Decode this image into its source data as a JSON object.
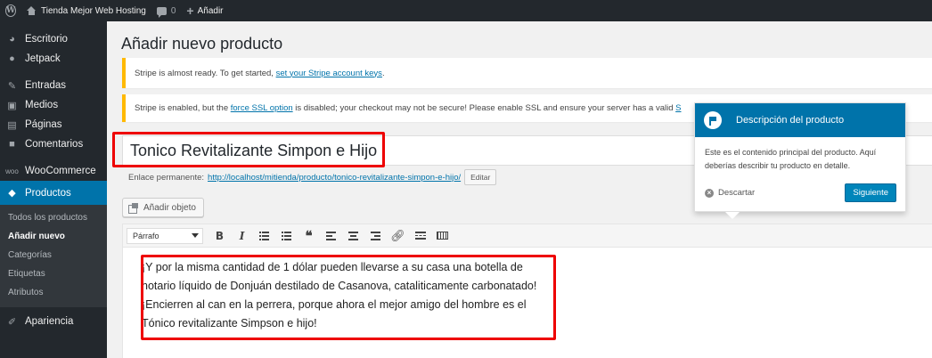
{
  "adminbar": {
    "site_name": "Tienda Mejor Web Hosting",
    "comments_count": "0",
    "new_label": "Añadir"
  },
  "sidebar": {
    "items": [
      {
        "label": "Escritorio",
        "icon": "dashboard-icon"
      },
      {
        "label": "Jetpack",
        "icon": "jetpack-icon"
      },
      {
        "label": "Entradas",
        "icon": "pin-icon"
      },
      {
        "label": "Medios",
        "icon": "media-icon"
      },
      {
        "label": "Páginas",
        "icon": "pages-icon"
      },
      {
        "label": "Comentarios",
        "icon": "comments-icon"
      },
      {
        "label": "WooCommerce",
        "icon": "woocommerce-icon"
      },
      {
        "label": "Productos",
        "icon": "products-icon"
      },
      {
        "label": "Apariencia",
        "icon": "appearance-icon"
      }
    ],
    "submenu": [
      "Todos los productos",
      "Añadir nuevo",
      "Categorías",
      "Etiquetas",
      "Atributos"
    ]
  },
  "page": {
    "title": "Añadir nuevo producto"
  },
  "notices": {
    "stripe_ready_text": "Stripe is almost ready. To get started, ",
    "stripe_ready_link": "set your Stripe account keys",
    "stripe_ready_end": ".",
    "ssl_text_1": "Stripe is enabled, but the ",
    "ssl_link": "force SSL option",
    "ssl_text_2": " is disabled; your checkout may not be secure! Please enable SSL and ensure your server has a valid ",
    "ssl_link_2": "S"
  },
  "product": {
    "title": "Tonico Revitalizante Simpon e Hijo",
    "permalink_label": "Enlace permanente:",
    "permalink_url": "http://localhost/mitienda/producto/tonico-revitalizante-simpon-e-hijo/",
    "edit_label": "Editar",
    "add_media_label": "Añadir objeto",
    "format_value": "Párrafo",
    "content": "¡Y por la misma cantidad de 1 dólar pueden llevarse a su casa una botella de notario líquido de Donjuán destilado de Casanova, cataliticamente carbonatado! ¡Encierren al can en la perrera, porque ahora el mejor amigo del hombre es el Tónico revitalizante Simpson e hijo!"
  },
  "tooltip": {
    "title": "Descripción del producto",
    "body": "Este es el contenido principal del producto. Aquí deberías describir tu producto en detalle.",
    "dismiss_label": "Descartar",
    "next_label": "Siguiente"
  },
  "colors": {
    "admin_bg": "#23282d",
    "accent": "#0073aa",
    "notice_warning": "#ffb900",
    "highlight": "#ee0000"
  }
}
